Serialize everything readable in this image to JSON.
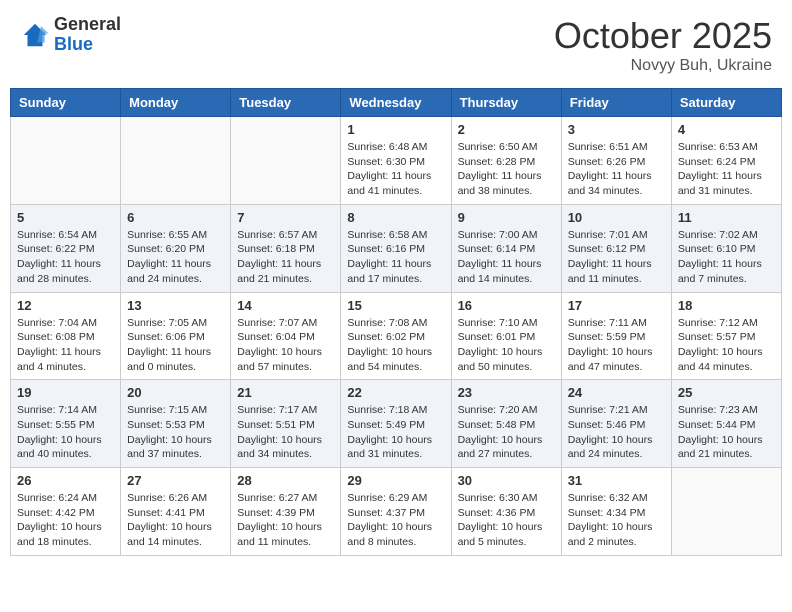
{
  "header": {
    "logo_general": "General",
    "logo_blue": "Blue",
    "month": "October 2025",
    "location": "Novyy Buh, Ukraine"
  },
  "days_of_week": [
    "Sunday",
    "Monday",
    "Tuesday",
    "Wednesday",
    "Thursday",
    "Friday",
    "Saturday"
  ],
  "weeks": [
    [
      {
        "day": "",
        "info": ""
      },
      {
        "day": "",
        "info": ""
      },
      {
        "day": "",
        "info": ""
      },
      {
        "day": "1",
        "info": "Sunrise: 6:48 AM\nSunset: 6:30 PM\nDaylight: 11 hours\nand 41 minutes."
      },
      {
        "day": "2",
        "info": "Sunrise: 6:50 AM\nSunset: 6:28 PM\nDaylight: 11 hours\nand 38 minutes."
      },
      {
        "day": "3",
        "info": "Sunrise: 6:51 AM\nSunset: 6:26 PM\nDaylight: 11 hours\nand 34 minutes."
      },
      {
        "day": "4",
        "info": "Sunrise: 6:53 AM\nSunset: 6:24 PM\nDaylight: 11 hours\nand 31 minutes."
      }
    ],
    [
      {
        "day": "5",
        "info": "Sunrise: 6:54 AM\nSunset: 6:22 PM\nDaylight: 11 hours\nand 28 minutes."
      },
      {
        "day": "6",
        "info": "Sunrise: 6:55 AM\nSunset: 6:20 PM\nDaylight: 11 hours\nand 24 minutes."
      },
      {
        "day": "7",
        "info": "Sunrise: 6:57 AM\nSunset: 6:18 PM\nDaylight: 11 hours\nand 21 minutes."
      },
      {
        "day": "8",
        "info": "Sunrise: 6:58 AM\nSunset: 6:16 PM\nDaylight: 11 hours\nand 17 minutes."
      },
      {
        "day": "9",
        "info": "Sunrise: 7:00 AM\nSunset: 6:14 PM\nDaylight: 11 hours\nand 14 minutes."
      },
      {
        "day": "10",
        "info": "Sunrise: 7:01 AM\nSunset: 6:12 PM\nDaylight: 11 hours\nand 11 minutes."
      },
      {
        "day": "11",
        "info": "Sunrise: 7:02 AM\nSunset: 6:10 PM\nDaylight: 11 hours\nand 7 minutes."
      }
    ],
    [
      {
        "day": "12",
        "info": "Sunrise: 7:04 AM\nSunset: 6:08 PM\nDaylight: 11 hours\nand 4 minutes."
      },
      {
        "day": "13",
        "info": "Sunrise: 7:05 AM\nSunset: 6:06 PM\nDaylight: 11 hours\nand 0 minutes."
      },
      {
        "day": "14",
        "info": "Sunrise: 7:07 AM\nSunset: 6:04 PM\nDaylight: 10 hours\nand 57 minutes."
      },
      {
        "day": "15",
        "info": "Sunrise: 7:08 AM\nSunset: 6:02 PM\nDaylight: 10 hours\nand 54 minutes."
      },
      {
        "day": "16",
        "info": "Sunrise: 7:10 AM\nSunset: 6:01 PM\nDaylight: 10 hours\nand 50 minutes."
      },
      {
        "day": "17",
        "info": "Sunrise: 7:11 AM\nSunset: 5:59 PM\nDaylight: 10 hours\nand 47 minutes."
      },
      {
        "day": "18",
        "info": "Sunrise: 7:12 AM\nSunset: 5:57 PM\nDaylight: 10 hours\nand 44 minutes."
      }
    ],
    [
      {
        "day": "19",
        "info": "Sunrise: 7:14 AM\nSunset: 5:55 PM\nDaylight: 10 hours\nand 40 minutes."
      },
      {
        "day": "20",
        "info": "Sunrise: 7:15 AM\nSunset: 5:53 PM\nDaylight: 10 hours\nand 37 minutes."
      },
      {
        "day": "21",
        "info": "Sunrise: 7:17 AM\nSunset: 5:51 PM\nDaylight: 10 hours\nand 34 minutes."
      },
      {
        "day": "22",
        "info": "Sunrise: 7:18 AM\nSunset: 5:49 PM\nDaylight: 10 hours\nand 31 minutes."
      },
      {
        "day": "23",
        "info": "Sunrise: 7:20 AM\nSunset: 5:48 PM\nDaylight: 10 hours\nand 27 minutes."
      },
      {
        "day": "24",
        "info": "Sunrise: 7:21 AM\nSunset: 5:46 PM\nDaylight: 10 hours\nand 24 minutes."
      },
      {
        "day": "25",
        "info": "Sunrise: 7:23 AM\nSunset: 5:44 PM\nDaylight: 10 hours\nand 21 minutes."
      }
    ],
    [
      {
        "day": "26",
        "info": "Sunrise: 6:24 AM\nSunset: 4:42 PM\nDaylight: 10 hours\nand 18 minutes."
      },
      {
        "day": "27",
        "info": "Sunrise: 6:26 AM\nSunset: 4:41 PM\nDaylight: 10 hours\nand 14 minutes."
      },
      {
        "day": "28",
        "info": "Sunrise: 6:27 AM\nSunset: 4:39 PM\nDaylight: 10 hours\nand 11 minutes."
      },
      {
        "day": "29",
        "info": "Sunrise: 6:29 AM\nSunset: 4:37 PM\nDaylight: 10 hours\nand 8 minutes."
      },
      {
        "day": "30",
        "info": "Sunrise: 6:30 AM\nSunset: 4:36 PM\nDaylight: 10 hours\nand 5 minutes."
      },
      {
        "day": "31",
        "info": "Sunrise: 6:32 AM\nSunset: 4:34 PM\nDaylight: 10 hours\nand 2 minutes."
      },
      {
        "day": "",
        "info": ""
      }
    ]
  ]
}
